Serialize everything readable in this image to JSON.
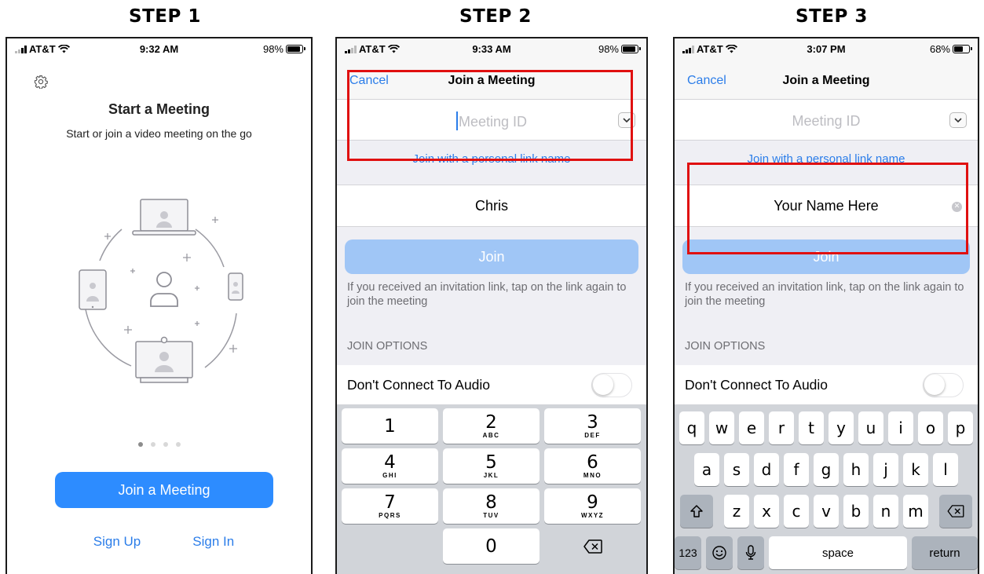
{
  "steps": [
    {
      "title": "STEP 1"
    },
    {
      "title": "STEP 2"
    },
    {
      "title": "STEP 3"
    }
  ],
  "phone1": {
    "status": {
      "carrier": "AT&T",
      "time": "9:32 AM",
      "battery": "98%",
      "battery_level": 0.98
    },
    "heading": "Start a Meeting",
    "subheading": "Start or join a video meeting on the go",
    "join_button": "Join a Meeting",
    "sign_up": "Sign Up",
    "sign_in": "Sign In",
    "page_indicator": {
      "count": 4,
      "active": 1
    }
  },
  "phone2": {
    "status": {
      "carrier": "AT&T",
      "time": "9:33 AM",
      "battery": "98%",
      "battery_level": 0.98
    },
    "cancel": "Cancel",
    "title": "Join a Meeting",
    "meeting_id_placeholder": "Meeting ID",
    "personal_link": "Join with a personal link name",
    "name_value": "Chris",
    "join_button": "Join",
    "help_text": "If you received an invitation link, tap on the link again to join the meeting",
    "options_header": "JOIN OPTIONS",
    "audio_option": "Don't Connect To Audio",
    "keypad": [
      {
        "digit": "1",
        "letters": ""
      },
      {
        "digit": "2",
        "letters": "ABC"
      },
      {
        "digit": "3",
        "letters": "DEF"
      },
      {
        "digit": "4",
        "letters": "GHI"
      },
      {
        "digit": "5",
        "letters": "JKL"
      },
      {
        "digit": "6",
        "letters": "MNO"
      },
      {
        "digit": "7",
        "letters": "PQRS"
      },
      {
        "digit": "8",
        "letters": "TUV"
      },
      {
        "digit": "9",
        "letters": "WXYZ"
      },
      {
        "digit": "0",
        "letters": ""
      }
    ]
  },
  "phone3": {
    "status": {
      "carrier": "AT&T",
      "time": "3:07 PM",
      "battery": "68%",
      "battery_level": 0.68
    },
    "cancel": "Cancel",
    "title": "Join a Meeting",
    "meeting_id_placeholder": "Meeting ID",
    "personal_link": "Join with a personal link name",
    "name_value": "Your Name Here",
    "join_button": "Join",
    "help_text": "If you received an invitation link, tap on the link again to join the meeting",
    "options_header": "JOIN OPTIONS",
    "audio_option": "Don't Connect To Audio",
    "keyboard": {
      "row1": [
        "q",
        "w",
        "e",
        "r",
        "t",
        "y",
        "u",
        "i",
        "o",
        "p"
      ],
      "row2": [
        "a",
        "s",
        "d",
        "f",
        "g",
        "h",
        "j",
        "k",
        "l"
      ],
      "row3": [
        "z",
        "x",
        "c",
        "v",
        "b",
        "n",
        "m"
      ],
      "num_key": "123",
      "space_key": "space",
      "return_key": "return"
    }
  },
  "colors": {
    "accent": "#2d8cff",
    "link": "#2b7de9",
    "highlight": "#e01010",
    "join_disabled": "#a0c6f6"
  }
}
